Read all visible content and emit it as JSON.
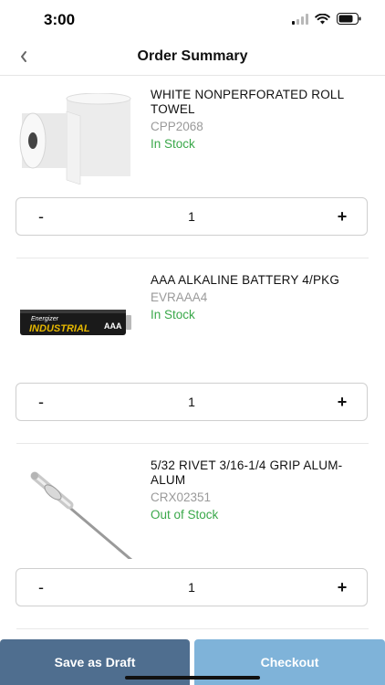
{
  "status": {
    "time": "3:00",
    "signal_icon": "cellular-signal-icon",
    "wifi_icon": "wifi-icon",
    "battery_icon": "battery-icon"
  },
  "header": {
    "title": "Order Summary",
    "back_icon": "chevron-left-icon"
  },
  "items": [
    {
      "name": "WHITE NONPERFORATED ROLL TOWEL",
      "sku": "CPP2068",
      "stock": "In Stock",
      "quantity": "1",
      "minus_label": "-",
      "plus_label": "+",
      "image_icon": "roll-towel-image"
    },
    {
      "name": "AAA ALKALINE BATTERY 4/PKG",
      "sku": "EVRAAA4",
      "stock": "In Stock",
      "quantity": "1",
      "minus_label": "-",
      "plus_label": "+",
      "image_icon": "battery-image",
      "image_text": {
        "brand": "Energizer",
        "line": "INDUSTRIAL",
        "size": "AAA"
      }
    },
    {
      "name": "5/32 RIVET 3/16-1/4 GRIP ALUM-ALUM",
      "sku": "CRX02351",
      "stock": "Out of Stock",
      "quantity": "1",
      "minus_label": "-",
      "plus_label": "+",
      "image_icon": "rivet-image"
    }
  ],
  "footer": {
    "save_draft_label": "Save as Draft",
    "checkout_label": "Checkout"
  },
  "colors": {
    "stock_green": "#3aa84a",
    "draft_button": "#4f6e8f",
    "checkout_button": "#7fb3d9"
  }
}
